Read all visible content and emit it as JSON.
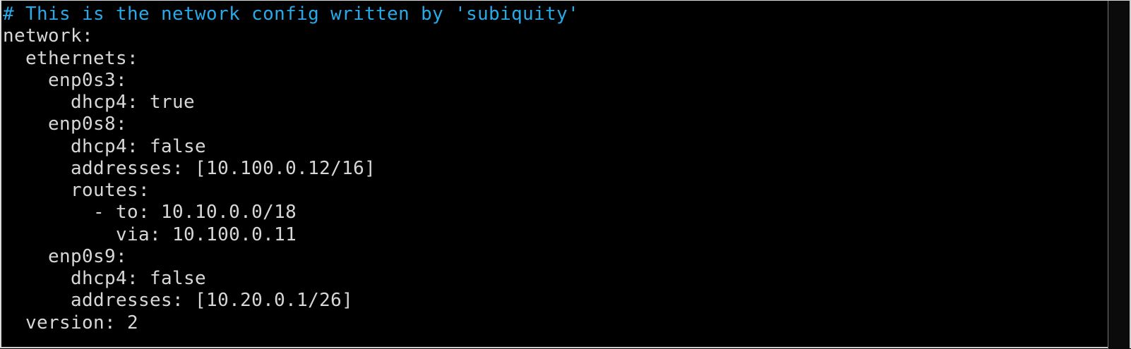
{
  "editor": {
    "lines": [
      "# This is the network config written by 'subiquity'",
      "network:",
      "  ethernets:",
      "    enp0s3:",
      "      dhcp4: true",
      "    enp0s8:",
      "      dhcp4: false",
      "      addresses: [10.100.0.12/16]",
      "      routes:",
      "        - to: 10.10.0.0/18",
      "          via: 10.100.0.11",
      "    enp0s9:",
      "      dhcp4: false",
      "      addresses: [10.20.0.1/26]",
      "  version: 2"
    ]
  },
  "colors": {
    "background": "#000000",
    "text": "#d7d7d7",
    "comment": "#28a9e8",
    "frame": "#d9d9d9"
  }
}
